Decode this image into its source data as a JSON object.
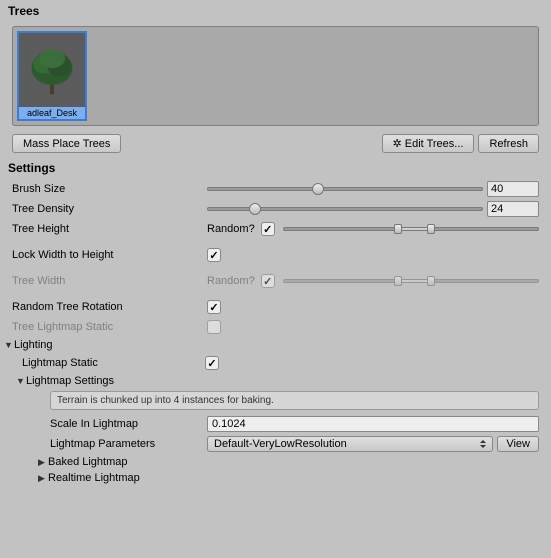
{
  "trees": {
    "header": "Trees",
    "thumb_label": "adleaf_Desk",
    "mass_place": "Mass Place Trees",
    "edit_trees": "Edit Trees...",
    "refresh": "Refresh"
  },
  "settings": {
    "header": "Settings",
    "brush_size": {
      "label": "Brush Size",
      "value": "40",
      "pct": 40
    },
    "tree_density": {
      "label": "Tree Density",
      "value": "24",
      "pct": 17
    },
    "tree_height": {
      "label": "Tree Height",
      "random_label": "Random?",
      "random": true,
      "lo": 45,
      "hi": 58
    },
    "lock_width": {
      "label": "Lock Width to Height",
      "checked": true
    },
    "tree_width": {
      "label": "Tree Width",
      "random_label": "Random?",
      "random": true,
      "lo": 45,
      "hi": 58
    },
    "random_rotation": {
      "label": "Random Tree Rotation",
      "checked": true
    },
    "tree_lm_static": {
      "label": "Tree Lightmap Static",
      "checked": false
    }
  },
  "lighting": {
    "header": "Lighting",
    "lm_static": {
      "label": "Lightmap Static",
      "checked": true
    },
    "lm_settings": {
      "header": "Lightmap Settings",
      "info": "Terrain is chunked up into 4 instances for baking.",
      "scale": {
        "label": "Scale In Lightmap",
        "value": "0.1024"
      },
      "params": {
        "label": "Lightmap Parameters",
        "value": "Default-VeryLowResolution",
        "view": "View"
      },
      "baked": "Baked Lightmap",
      "realtime": "Realtime Lightmap"
    }
  }
}
